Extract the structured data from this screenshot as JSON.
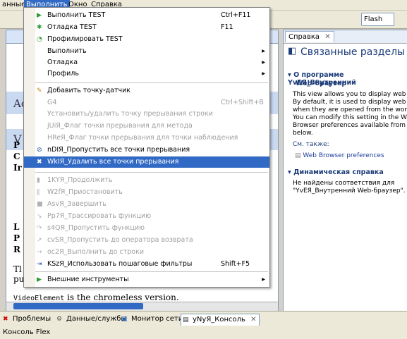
{
  "menubar": {
    "items": [
      {
        "label": "анные",
        "active": false
      },
      {
        "label": "Выполнить",
        "active": true
      },
      {
        "label": "Окно",
        "active": false
      },
      {
        "label": "Справка",
        "active": false
      }
    ]
  },
  "toolbar": {
    "perspective_label": "Flash"
  },
  "editor": {
    "text_a": "Ac",
    "text_v": "V",
    "text_p1": "P",
    "text_c": "C",
    "text_i": "Ir",
    "text_l": "L",
    "text_p2": "P",
    "text_r": "R",
    "text_t": "Tl",
    "text_pu": "pu",
    "footer_prefix": "VideoElement",
    "footer_suffix": " is the chromeless version."
  },
  "menu": {
    "items": [
      {
        "label": "Выполнить TEST",
        "accel": "Ctrl+F11",
        "icon": "run-icon",
        "disabled": false
      },
      {
        "label": "Отладка TEST",
        "accel": "F11",
        "icon": "debug-icon",
        "disabled": false
      },
      {
        "label": "Профилировать TEST",
        "accel": "",
        "icon": "profile-icon",
        "disabled": false
      },
      {
        "label": "Выполнить",
        "accel": "",
        "icon": "",
        "submenu": true,
        "disabled": false
      },
      {
        "label": "Отладка",
        "accel": "",
        "icon": "",
        "submenu": true,
        "disabled": false
      },
      {
        "label": "Профиль",
        "accel": "",
        "icon": "",
        "submenu": true,
        "disabled": false
      },
      {
        "label": "Добавить точку-датчик",
        "accel": "",
        "icon": "watchpoint-icon",
        "disabled": false
      },
      {
        "label": "G4",
        "accel": "Ctrl+Shift+B",
        "icon": "",
        "disabled": true
      },
      {
        "label": "Установить/удалить точку прерывания строки",
        "accel": "",
        "icon": "",
        "disabled": true
      },
      {
        "label": "jUiЯ_Флаг точки прерывания для метода",
        "accel": "",
        "icon": "",
        "disabled": true
      },
      {
        "label": "HReЯ_Флаг точки прерывания для точки наблюдения",
        "accel": "",
        "icon": "",
        "disabled": true
      },
      {
        "label": "nDIЯ_Пропустить все точки прерывания",
        "accel": "",
        "icon": "skip-breakpoints-icon",
        "disabled": false
      },
      {
        "label": "WkIЯ_Удалить все точки прерывания",
        "accel": "",
        "icon": "remove-breakpoints-icon",
        "disabled": false,
        "highlighted": true
      },
      {
        "label": "1KYЯ_Продолжить",
        "accel": "",
        "icon": "resume-icon",
        "disabled": true
      },
      {
        "label": "W2fЯ_Приостановить",
        "accel": "",
        "icon": "suspend-icon",
        "disabled": true
      },
      {
        "label": "AsvЯ_Завершить",
        "accel": "",
        "icon": "terminate-icon",
        "disabled": true
      },
      {
        "label": "Pp7Я_Трассировать функцию",
        "accel": "",
        "icon": "step-into-icon",
        "disabled": true
      },
      {
        "label": "s4QЯ_Пропустить функцию",
        "accel": "",
        "icon": "step-over-icon",
        "disabled": true
      },
      {
        "label": "cvSЯ_Пропустить до оператора возврата",
        "accel": "",
        "icon": "step-return-icon",
        "disabled": true
      },
      {
        "label": "oc2Я_Выполнить до строки",
        "accel": "",
        "icon": "run-to-line-icon",
        "disabled": true
      },
      {
        "label": "KSzЯ_Использовать пошаговые фильтры",
        "accel": "Shift+F5",
        "icon": "step-filter-icon",
        "disabled": false
      },
      {
        "label": "Внешние инструменты",
        "accel": "",
        "icon": "external-tools-icon",
        "submenu": true,
        "disabled": false
      }
    ]
  },
  "help": {
    "tab_label": "Справка",
    "title": "Связанные разделы",
    "section1": "О программе YvEЯ_Внутренний",
    "section1_cont": "Web-браузер",
    "desc_lines": [
      "This view allows you to display web pag",
      "By default, it is used to display web pag",
      "when they are opened from the workbe",
      "You can modify this setting in the Web",
      "Browser preferences available from the",
      "below."
    ],
    "see_also": "См. также:",
    "see_also_link": "Web Browser preferences",
    "section2": "Динамическая справка",
    "dyn_line1": "Не найдены соответствия для",
    "dyn_line2": "\"YvEЯ_Внутренний Web-браузер\"."
  },
  "bottom": {
    "tabs": [
      "Проблемы",
      "Данные/службы",
      "Монитор сети",
      "yNyЯ_Консоль"
    ],
    "console_label": "Консоль Flex"
  },
  "colors": {
    "highlight": "#316ac5",
    "section_title": "#1c3c78"
  }
}
